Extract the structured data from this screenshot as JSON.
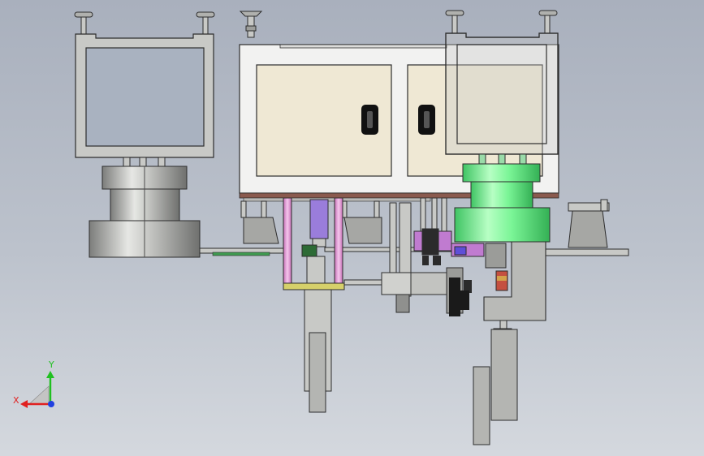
{
  "colors": {
    "background_top": "#a9b0bd",
    "background_bottom": "#d4d8de",
    "metal": "#c8c9c6",
    "metal_dark": "#8f908e",
    "cabinet_white": "#f2f2f1",
    "cabinet_panel": "#efe8d4",
    "outline": "#2d2d2d",
    "cylinder_green": "#6ef08a",
    "rod_pink": "#e59bd6",
    "rod_violet": "#9a7ddb",
    "brown_base": "#8a5a4e",
    "plate_yellow": "#d6d06a",
    "axis_x": "#e02020",
    "axis_y": "#20c020",
    "axis_z": "#2040e0"
  },
  "view_triad": {
    "x_label": "X",
    "y_label": "Y"
  },
  "icons": [
    "coordinate-triad-icon",
    "door-handle-icon"
  ]
}
